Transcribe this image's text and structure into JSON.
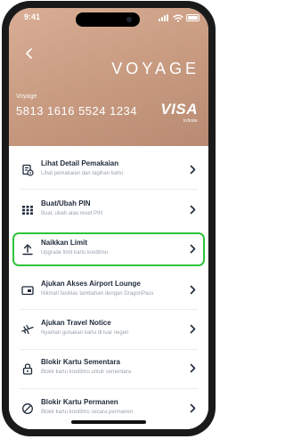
{
  "status": {
    "time": "9:41"
  },
  "card": {
    "brand": "VOYAGE",
    "label": "Voyage",
    "number": "5813 1616 5524 1234",
    "network": "VISA",
    "network_tier": "Infinite",
    "color": "#c99c82"
  },
  "menu": {
    "selected_color": "#2fc43a",
    "items": [
      {
        "title": "Lihat Detail Pemakaian",
        "subtitle": "Lihat pemakaian dan tagihan kartu",
        "icon": "receipt-icon"
      },
      {
        "title": "Buat/Ubah PIN",
        "subtitle": "Buat, ubah atau reset PIN",
        "icon": "pin-keypad-icon"
      },
      {
        "title": "Naikkan Limit",
        "subtitle": "Upgrade limit kartu kreditmu",
        "icon": "upload-arrow-icon"
      },
      {
        "title": "Ajukan Akses Airport Lounge",
        "subtitle": "Nikmati fasilitas tambahan dengan DragonPass",
        "icon": "lounge-card-icon"
      },
      {
        "title": "Ajukan Travel Notice",
        "subtitle": "Nyaman gunakan kartu di luar negeri",
        "icon": "airplane-icon"
      },
      {
        "title": "Blokir Kartu Sementara",
        "subtitle": "Blokir kartu kreditmu untuk sementara",
        "icon": "lock-icon"
      },
      {
        "title": "Blokir Kartu Permanen",
        "subtitle": "Blokir kartu kreditmu secara permanen",
        "icon": "block-icon"
      }
    ]
  }
}
